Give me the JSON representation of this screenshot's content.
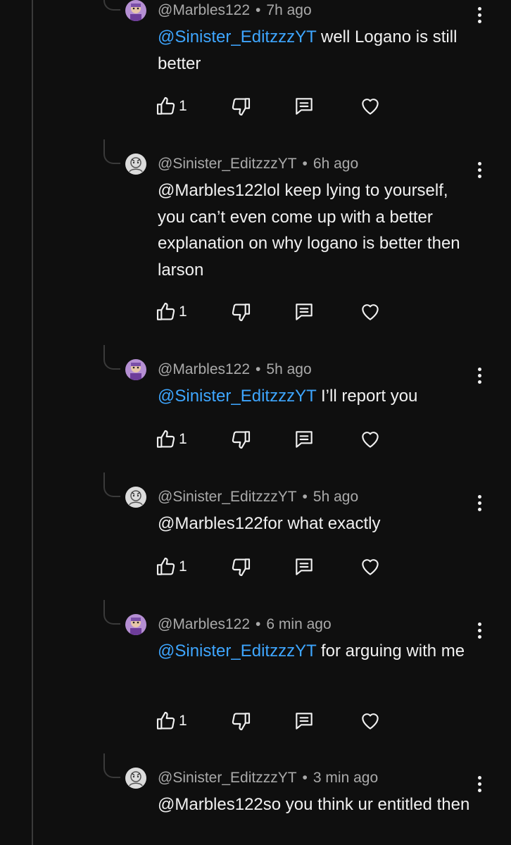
{
  "comments": [
    {
      "author": "@Marbles122",
      "time": "7h ago",
      "mention": "@Sinister_EditzzzYT",
      "text_rest": " well Logano is still better",
      "likes": "1",
      "avatar": "purple-character-avatar"
    },
    {
      "author": "@Sinister_EditzzzYT",
      "time": "6h ago",
      "mention": "",
      "text_rest": "@Marbles122lol keep lying to yourself, you can’t even come up with a better explanation on why logano is better then larson",
      "likes": "1",
      "avatar": "gray-sketch-avatar"
    },
    {
      "author": "@Marbles122",
      "time": "5h ago",
      "mention": "@Sinister_EditzzzYT",
      "text_rest": " I’ll report you",
      "likes": "1",
      "avatar": "purple-character-avatar"
    },
    {
      "author": "@Sinister_EditzzzYT",
      "time": "5h ago",
      "mention": "",
      "text_rest": "@Marbles122for what exactly",
      "likes": "1",
      "avatar": "gray-sketch-avatar"
    },
    {
      "author": "@Marbles122",
      "time": "6 min ago",
      "mention": "@Sinister_EditzzzYT",
      "text_rest": " for arguing with me",
      "likes": "1",
      "avatar": "purple-character-avatar"
    },
    {
      "author": "@Sinister_EditzzzYT",
      "time": "3 min ago",
      "mention": "",
      "text_rest": "@Marbles122so you think ur entitled then",
      "likes": "",
      "avatar": "gray-sketch-avatar"
    }
  ],
  "separator": "•",
  "icons": {
    "like": "thumbs-up-icon",
    "dislike": "thumbs-down-icon",
    "reply": "reply-comment-icon",
    "heart": "heart-icon",
    "more": "more-vertical-icon"
  },
  "colors": {
    "background": "#0f0f0f",
    "text": "#f1f1f1",
    "meta": "#aaaaaa",
    "mention": "#3ea6ff",
    "thread": "#3a3a3a"
  }
}
